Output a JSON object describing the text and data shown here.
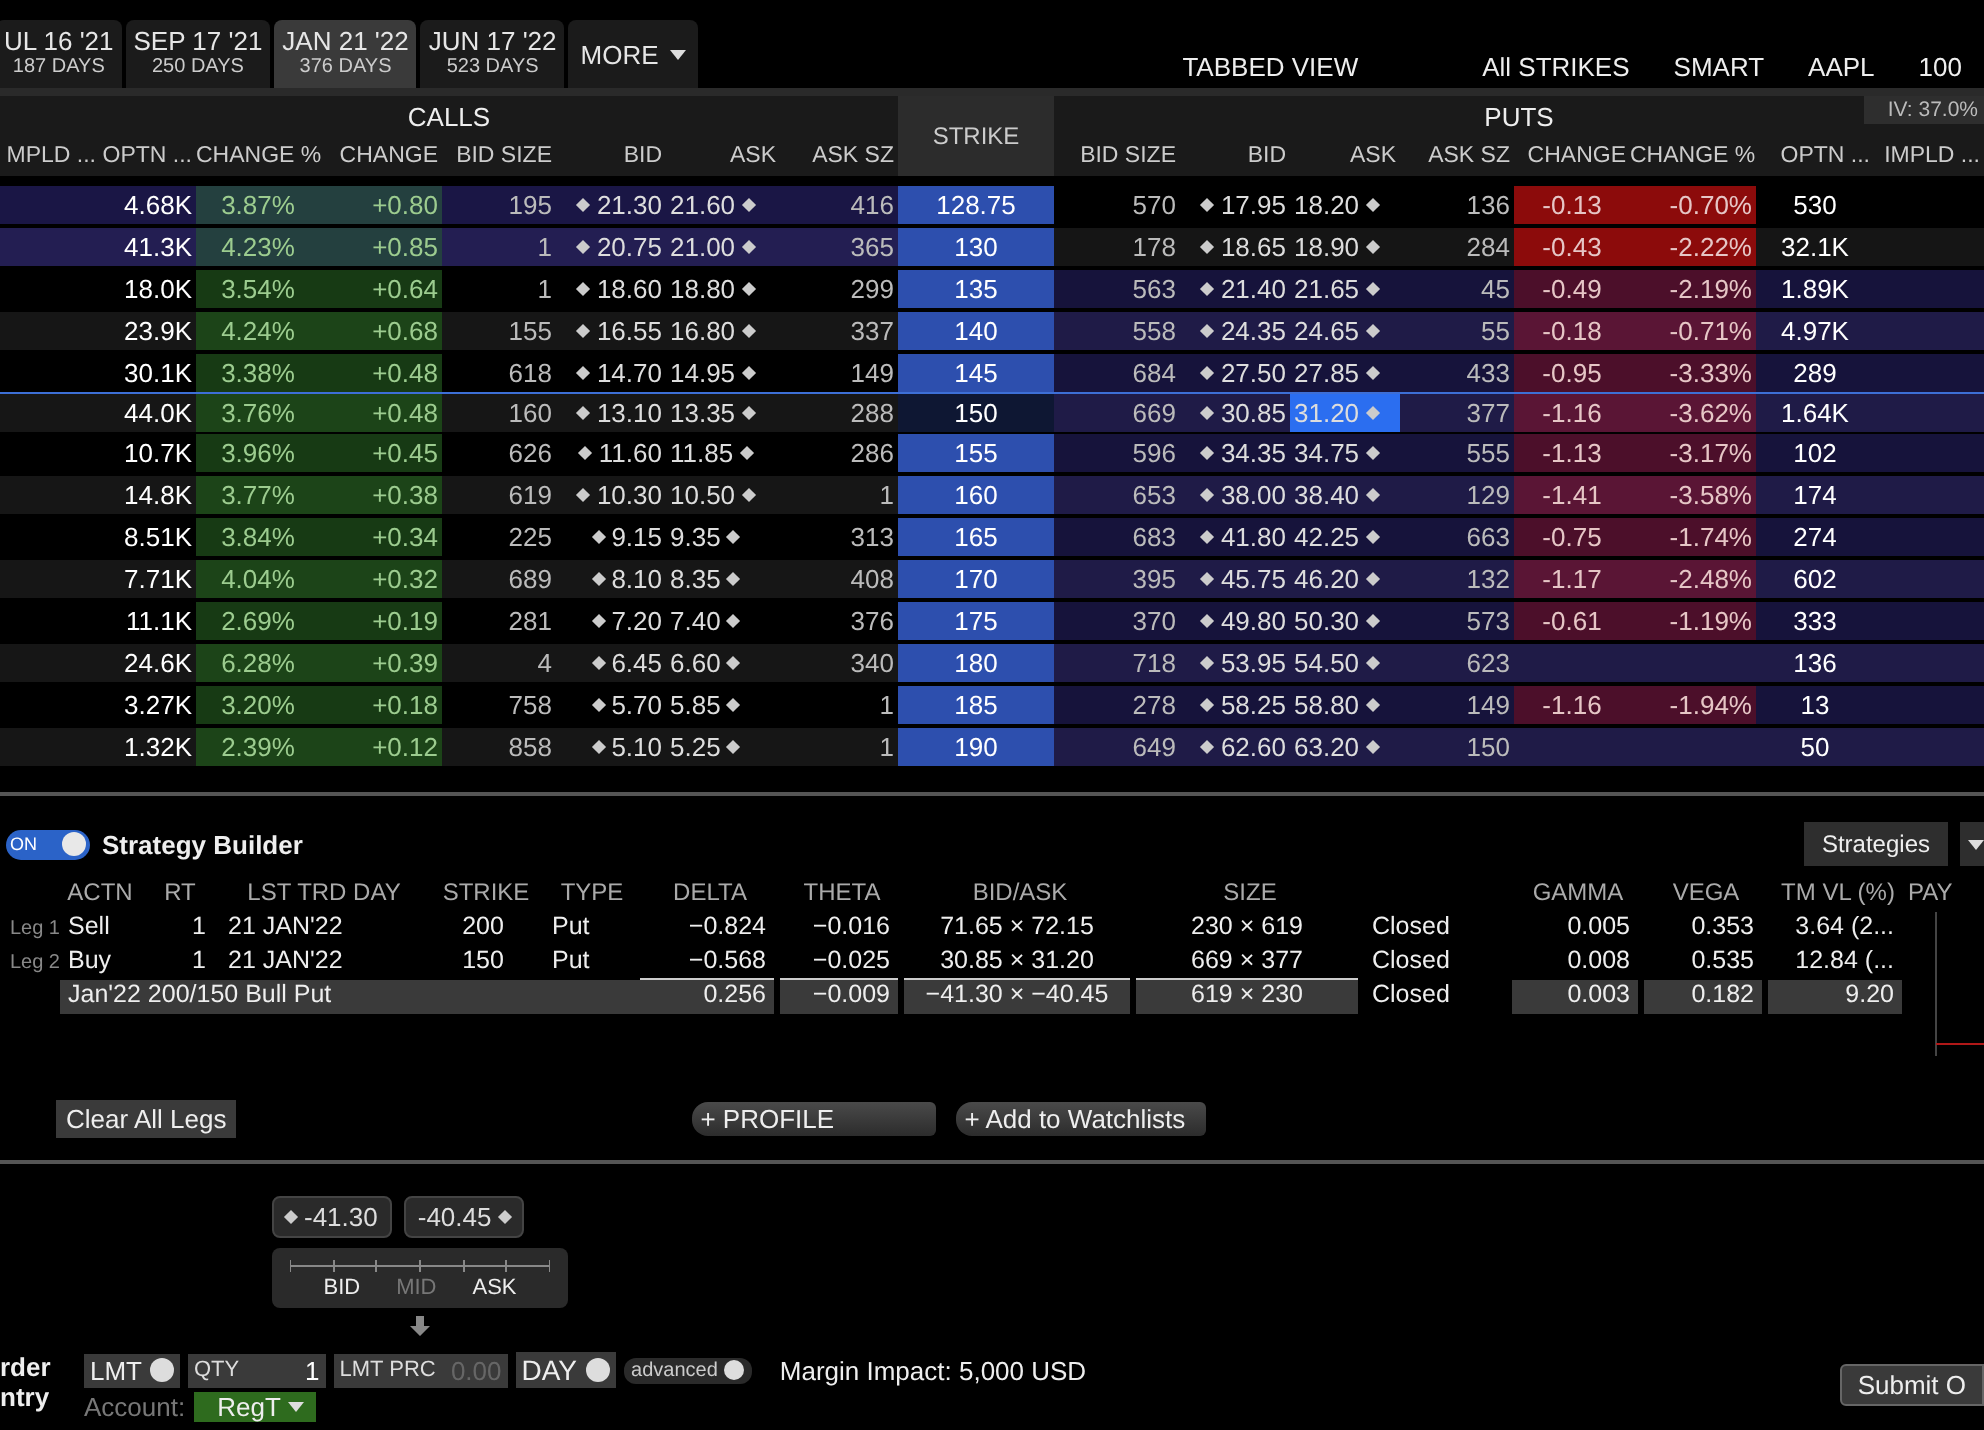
{
  "expiry_tabs": [
    {
      "date": "UL 16 '21",
      "days": "187 DAYS",
      "selected": false
    },
    {
      "date": "SEP 17 '21",
      "days": "250 DAYS",
      "selected": false
    },
    {
      "date": "JAN 21 '22",
      "days": "376 DAYS",
      "selected": true
    },
    {
      "date": "JUN 17 '22",
      "days": "523 DAYS",
      "selected": false
    }
  ],
  "more_tab": "MORE",
  "toolbar": [
    "TABBED VIEW",
    "All STRIKES",
    "SMART",
    "AAPL",
    "100"
  ],
  "iv_badge": "IV: 37.0%",
  "chain": {
    "calls_title": "CALLS",
    "puts_title": "PUTS",
    "strike_header": "STRIKE",
    "call_columns": [
      "MPLD ...",
      "OPTN ...",
      "CHANGE %",
      "CHANGE",
      "BID SIZE",
      "BID",
      "ASK",
      "ASK SZ"
    ],
    "put_columns": [
      "BID SIZE",
      "BID",
      "ASK",
      "ASK SZ",
      "CHANGE",
      "CHANGE %",
      "OPTN ...",
      "IMPLD ..."
    ],
    "rows": [
      {
        "strike": "128.75",
        "selected": false,
        "calls_itm": true,
        "puts_itm": false,
        "calls": {
          "optn": "4.68K",
          "change_pct": "3.87%",
          "change": "+0.80",
          "bid_size": "195",
          "bid": "21.30",
          "ask": "21.60",
          "ask_size": "416"
        },
        "puts": {
          "bid_size": "570",
          "bid": "17.95",
          "ask": "18.20",
          "ask_size": "136",
          "change": "-0.13",
          "change_pct": "-0.70%",
          "optn": "530",
          "ask_selected": false
        }
      },
      {
        "strike": "130",
        "selected": false,
        "calls_itm": true,
        "puts_itm": false,
        "calls": {
          "optn": "41.3K",
          "change_pct": "4.23%",
          "change": "+0.85",
          "bid_size": "1",
          "bid": "20.75",
          "ask": "21.00",
          "ask_size": "365"
        },
        "puts": {
          "bid_size": "178",
          "bid": "18.65",
          "ask": "18.90",
          "ask_size": "284",
          "change": "-0.43",
          "change_pct": "-2.22%",
          "optn": "32.1K",
          "ask_selected": false
        }
      },
      {
        "strike": "135",
        "selected": false,
        "calls_itm": false,
        "puts_itm": true,
        "calls": {
          "optn": "18.0K",
          "change_pct": "3.54%",
          "change": "+0.64",
          "bid_size": "1",
          "bid": "18.60",
          "ask": "18.80",
          "ask_size": "299"
        },
        "puts": {
          "bid_size": "563",
          "bid": "21.40",
          "ask": "21.65",
          "ask_size": "45",
          "change": "-0.49",
          "change_pct": "-2.19%",
          "optn": "1.89K",
          "ask_selected": false
        }
      },
      {
        "strike": "140",
        "selected": false,
        "calls_itm": false,
        "puts_itm": true,
        "calls": {
          "optn": "23.9K",
          "change_pct": "4.24%",
          "change": "+0.68",
          "bid_size": "155",
          "bid": "16.55",
          "ask": "16.80",
          "ask_size": "337"
        },
        "puts": {
          "bid_size": "558",
          "bid": "24.35",
          "ask": "24.65",
          "ask_size": "55",
          "change": "-0.18",
          "change_pct": "-0.71%",
          "optn": "4.97K",
          "ask_selected": false
        }
      },
      {
        "strike": "145",
        "selected": false,
        "calls_itm": false,
        "puts_itm": true,
        "calls": {
          "optn": "30.1K",
          "change_pct": "3.38%",
          "change": "+0.48",
          "bid_size": "618",
          "bid": "14.70",
          "ask": "14.95",
          "ask_size": "149"
        },
        "puts": {
          "bid_size": "684",
          "bid": "27.50",
          "ask": "27.85",
          "ask_size": "433",
          "change": "-0.95",
          "change_pct": "-3.33%",
          "optn": "289",
          "ask_selected": false
        }
      },
      {
        "strike": "150",
        "selected": true,
        "calls_itm": false,
        "puts_itm": true,
        "calls": {
          "optn": "44.0K",
          "change_pct": "3.76%",
          "change": "+0.48",
          "bid_size": "160",
          "bid": "13.10",
          "ask": "13.35",
          "ask_size": "288"
        },
        "puts": {
          "bid_size": "669",
          "bid": "30.85",
          "ask": "31.20",
          "ask_size": "377",
          "change": "-1.16",
          "change_pct": "-3.62%",
          "optn": "1.64K",
          "ask_selected": true
        }
      },
      {
        "strike": "155",
        "selected": false,
        "calls_itm": false,
        "puts_itm": true,
        "calls": {
          "optn": "10.7K",
          "change_pct": "3.96%",
          "change": "+0.45",
          "bid_size": "626",
          "bid": "11.60",
          "ask": "11.85",
          "ask_size": "286"
        },
        "puts": {
          "bid_size": "596",
          "bid": "34.35",
          "ask": "34.75",
          "ask_size": "555",
          "change": "-1.13",
          "change_pct": "-3.17%",
          "optn": "102",
          "ask_selected": false
        }
      },
      {
        "strike": "160",
        "selected": false,
        "calls_itm": false,
        "puts_itm": true,
        "calls": {
          "optn": "14.8K",
          "change_pct": "3.77%",
          "change": "+0.38",
          "bid_size": "619",
          "bid": "10.30",
          "ask": "10.50",
          "ask_size": "1"
        },
        "puts": {
          "bid_size": "653",
          "bid": "38.00",
          "ask": "38.40",
          "ask_size": "129",
          "change": "-1.41",
          "change_pct": "-3.58%",
          "optn": "174",
          "ask_selected": false
        }
      },
      {
        "strike": "165",
        "selected": false,
        "calls_itm": false,
        "puts_itm": true,
        "calls": {
          "optn": "8.51K",
          "change_pct": "3.84%",
          "change": "+0.34",
          "bid_size": "225",
          "bid": "9.15",
          "ask": "9.35",
          "ask_size": "313"
        },
        "puts": {
          "bid_size": "683",
          "bid": "41.80",
          "ask": "42.25",
          "ask_size": "663",
          "change": "-0.75",
          "change_pct": "-1.74%",
          "optn": "274",
          "ask_selected": false
        }
      },
      {
        "strike": "170",
        "selected": false,
        "calls_itm": false,
        "puts_itm": true,
        "calls": {
          "optn": "7.71K",
          "change_pct": "4.04%",
          "change": "+0.32",
          "bid_size": "689",
          "bid": "8.10",
          "ask": "8.35",
          "ask_size": "408"
        },
        "puts": {
          "bid_size": "395",
          "bid": "45.75",
          "ask": "46.20",
          "ask_size": "132",
          "change": "-1.17",
          "change_pct": "-2.48%",
          "optn": "602",
          "ask_selected": false
        }
      },
      {
        "strike": "175",
        "selected": false,
        "calls_itm": false,
        "puts_itm": true,
        "calls": {
          "optn": "11.1K",
          "change_pct": "2.69%",
          "change": "+0.19",
          "bid_size": "281",
          "bid": "7.20",
          "ask": "7.40",
          "ask_size": "376"
        },
        "puts": {
          "bid_size": "370",
          "bid": "49.80",
          "ask": "50.30",
          "ask_size": "573",
          "change": "-0.61",
          "change_pct": "-1.19%",
          "optn": "333",
          "ask_selected": false
        }
      },
      {
        "strike": "180",
        "selected": false,
        "calls_itm": false,
        "puts_itm": true,
        "calls": {
          "optn": "24.6K",
          "change_pct": "6.28%",
          "change": "+0.39",
          "bid_size": "4",
          "bid": "6.45",
          "ask": "6.60",
          "ask_size": "340"
        },
        "puts": {
          "bid_size": "718",
          "bid": "53.95",
          "ask": "54.50",
          "ask_size": "623",
          "optn": "136",
          "ask_selected": false
        }
      },
      {
        "strike": "185",
        "selected": false,
        "calls_itm": false,
        "puts_itm": true,
        "calls": {
          "optn": "3.27K",
          "change_pct": "3.20%",
          "change": "+0.18",
          "bid_size": "758",
          "bid": "5.70",
          "ask": "5.85",
          "ask_size": "1"
        },
        "puts": {
          "bid_size": "278",
          "bid": "58.25",
          "ask": "58.80",
          "ask_size": "149",
          "change": "-1.16",
          "change_pct": "-1.94%",
          "optn": "13",
          "ask_selected": false
        }
      },
      {
        "strike": "190",
        "selected": false,
        "calls_itm": false,
        "puts_itm": true,
        "calls": {
          "optn": "1.32K",
          "change_pct": "2.39%",
          "change": "+0.12",
          "bid_size": "858",
          "bid": "5.10",
          "ask": "5.25",
          "ask_size": "1"
        },
        "puts": {
          "bid_size": "649",
          "bid": "62.60",
          "ask": "63.20",
          "ask_size": "150",
          "optn": "50",
          "ask_selected": false
        }
      }
    ]
  },
  "strategy_builder": {
    "toggle": {
      "label": "ON",
      "on": true
    },
    "title": "Strategy Builder",
    "strategies_button": "Strategies",
    "columns": [
      "ACTN",
      "RT",
      "LST TRD DAY",
      "STRIKE",
      "TYPE",
      "DELTA",
      "THETA",
      "BID/ASK",
      "SIZE",
      "",
      "GAMMA",
      "VEGA",
      "TM VL (%)",
      "PAY"
    ],
    "legs": [
      {
        "leg": "Leg 1",
        "action": "Sell",
        "ratio": "1",
        "last_trade_day": "21 JAN'22",
        "strike": "200",
        "type": "Put",
        "delta": "−0.824",
        "theta": "−0.016",
        "bid_ask": "71.65 × 72.15",
        "size": "230 × 619",
        "status": "Closed",
        "gamma": "0.005",
        "vega": "0.353",
        "tm_vl": "3.64 (2..."
      },
      {
        "leg": "Leg 2",
        "action": "Buy",
        "ratio": "1",
        "last_trade_day": "21 JAN'22",
        "strike": "150",
        "type": "Put",
        "delta": "−0.568",
        "theta": "−0.025",
        "bid_ask": "30.85 × 31.20",
        "size": "669 × 377",
        "status": "Closed",
        "gamma": "0.008",
        "vega": "0.535",
        "tm_vl": "12.84 (..."
      }
    ],
    "summary": {
      "name": "Jan'22 200/150 Bull Put",
      "delta": "0.256",
      "theta": "−0.009",
      "bid_ask": "−41.30 × −40.45",
      "size": "619 × 230",
      "status": "Closed",
      "gamma": "0.003",
      "vega": "0.182",
      "tm_vl": "9.20"
    },
    "buttons": [
      {
        "kind": "plain",
        "label": "Clear All Legs"
      },
      {
        "kind": "pill",
        "label": "+ PROFILE"
      },
      {
        "kind": "pill",
        "label": "+ Add to Watchlists"
      }
    ]
  },
  "order_entry": {
    "label_lines": [
      "rder",
      "ntry"
    ],
    "bid_price": "-41.30",
    "ask_price": "-40.45",
    "slider_labels": [
      {
        "label": "BID",
        "disabled": false
      },
      {
        "label": "MID",
        "disabled": true
      },
      {
        "label": "ASK",
        "disabled": false
      }
    ],
    "order_type": "LMT",
    "qty_label": "QTY",
    "qty": "1",
    "limit_price_label": "LMT PRC",
    "limit_price_placeholder": "0.00",
    "time_in_force": "DAY",
    "advanced": "advanced",
    "margin_impact": "Margin Impact: 5,000 USD",
    "account_label": "Account:",
    "account": "RegT",
    "submit": "Submit O"
  }
}
